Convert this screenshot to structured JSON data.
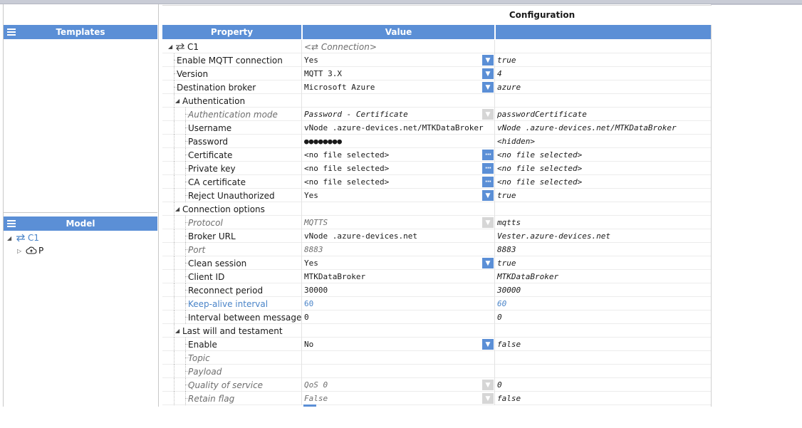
{
  "templates_panel": {
    "title": "Templates"
  },
  "model_panel": {
    "title": "Model",
    "tree": [
      {
        "label": "C1",
        "expanded": true,
        "icon": "connection-icon"
      },
      {
        "label": "P",
        "expanded": false,
        "icon": "cloud-upload-icon"
      }
    ]
  },
  "config": {
    "title": "Configuration"
  },
  "grid": {
    "headers": {
      "property": "Property",
      "value": "Value",
      "third": ""
    },
    "rows": [
      {
        "name": "C1",
        "value": "<⇄ Connection>",
        "third": "",
        "level": 0,
        "group": true,
        "value_style": "ital grey"
      },
      {
        "name": "Enable MQTT connection",
        "value": "Yes",
        "third": "true",
        "level": 1,
        "control": "dropdown"
      },
      {
        "name": "Version",
        "value": "MQTT 3.X",
        "third": "4",
        "level": 1,
        "control": "dropdown"
      },
      {
        "name": "Destination broker",
        "value": "Microsoft Azure",
        "third": "azure",
        "level": 1,
        "control": "dropdown"
      },
      {
        "name": "Authentication",
        "value": "",
        "third": "",
        "level": 1,
        "group": true
      },
      {
        "name": "Authentication mode",
        "value": "Password - Certificate",
        "third": "passwordCertificate",
        "level": 2,
        "control": "dropdown-off",
        "name_style": "ital grey",
        "value_style": "ital"
      },
      {
        "name": "Username",
        "value": "vNode .azure-devices.net/MTKDataBroker",
        "third": "vNode .azure-devices.net/MTKDataBroker",
        "level": 2
      },
      {
        "name": "Password",
        "value": "●●●●●●●●",
        "third": "<hidden>",
        "level": 2
      },
      {
        "name": "Certificate",
        "value": "<no file selected>",
        "third": "<no file selected>",
        "level": 2,
        "control": "dots"
      },
      {
        "name": "Private key",
        "value": "<no file selected>",
        "third": "<no file selected>",
        "level": 2,
        "control": "dots"
      },
      {
        "name": "CA certificate",
        "value": "<no file selected>",
        "third": "<no file selected>",
        "level": 2,
        "control": "dots"
      },
      {
        "name": "Reject Unauthorized",
        "value": "Yes",
        "third": "true",
        "level": 2,
        "control": "dropdown"
      },
      {
        "name": "Connection options",
        "value": "",
        "third": "",
        "level": 1,
        "group": true
      },
      {
        "name": "Protocol",
        "value": "MQTTS",
        "third": "mqtts",
        "level": 2,
        "control": "dropdown-off",
        "name_style": "ital grey",
        "value_style": "ital grey"
      },
      {
        "name": "Broker URL",
        "value": "vNode .azure-devices.net",
        "third": "Vester.azure-devices.net",
        "level": 2
      },
      {
        "name": "Port",
        "value": "8883",
        "third": "8883",
        "level": 2,
        "name_style": "ital grey",
        "value_style": "ital grey"
      },
      {
        "name": "Clean session",
        "value": "Yes",
        "third": "true",
        "level": 2,
        "control": "dropdown"
      },
      {
        "name": "Client ID",
        "value": "MTKDataBroker",
        "third": "MTKDataBroker",
        "level": 2
      },
      {
        "name": "Reconnect period",
        "value": "30000",
        "third": "30000",
        "level": 2
      },
      {
        "name": "Keep-alive interval",
        "value": "60",
        "third": "60",
        "level": 2,
        "name_style": "blue",
        "value_style": "blue",
        "third_style": "blue"
      },
      {
        "name": "Interval between messages",
        "value": "0",
        "third": "0",
        "level": 2
      },
      {
        "name": "Last will and testament",
        "value": "",
        "third": "",
        "level": 1,
        "group": true
      },
      {
        "name": "Enable",
        "value": "No",
        "third": "false",
        "level": 2,
        "control": "dropdown"
      },
      {
        "name": "Topic",
        "value": "",
        "third": "",
        "level": 2,
        "name_style": "ital grey"
      },
      {
        "name": "Payload",
        "value": "",
        "third": "",
        "level": 2,
        "name_style": "ital grey"
      },
      {
        "name": "Quality of service",
        "value": "QoS 0",
        "third": "0",
        "level": 2,
        "control": "dropdown-off",
        "name_style": "ital grey",
        "value_style": "ital grey"
      },
      {
        "name": "Retain flag",
        "value": "False",
        "third": "false",
        "level": 2,
        "control": "dropdown-off",
        "name_style": "ital grey",
        "value_style": "ital grey"
      }
    ]
  },
  "colors": {
    "header_blue": "#5b8fd6",
    "accent_blue": "#4a84c8"
  }
}
